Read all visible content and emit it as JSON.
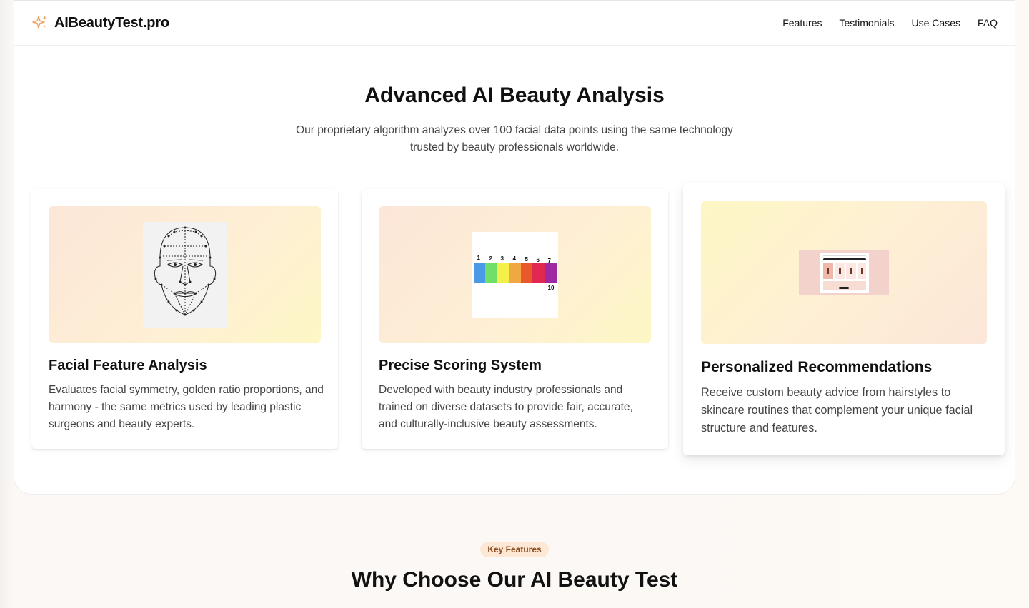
{
  "brand": {
    "name": "AIBeautyTest.pro",
    "icon": "sparkle-icon",
    "accent": "#f0a868"
  },
  "nav": {
    "items": [
      "Features",
      "Testimonials",
      "Use Cases",
      "FAQ"
    ]
  },
  "hero": {
    "title": "Advanced AI Beauty Analysis",
    "subtitle": "Our proprietary algorithm analyzes over 100 facial data points using the same technology trusted by beauty professionals worldwide."
  },
  "cards": [
    {
      "title": "Facial Feature Analysis",
      "description": "Evaluates facial symmetry, golden ratio proportions, and harmony - the same metrics used by leading plastic surgeons and beauty experts."
    },
    {
      "title": "Precise Scoring System",
      "description": "Developed with beauty industry professionals and trained on diverse datasets to provide fair, accurate, and culturally-inclusive beauty assessments.",
      "scale_labels": [
        "1",
        "2",
        "3",
        "4",
        "5",
        "6",
        "7"
      ],
      "scale_max": "10",
      "scale_colors": [
        "#4a9ae6",
        "#6ee06a",
        "#f4f04a",
        "#f0a840",
        "#e8582a",
        "#e02850",
        "#a028a0"
      ]
    },
    {
      "title": "Personalized Recommendations",
      "description": "Receive custom beauty advice from hairstyles to skincare routines that complement your unique facial structure and features."
    }
  ],
  "features": {
    "tag": "Key Features",
    "title": "Why Choose Our AI Beauty Test"
  }
}
